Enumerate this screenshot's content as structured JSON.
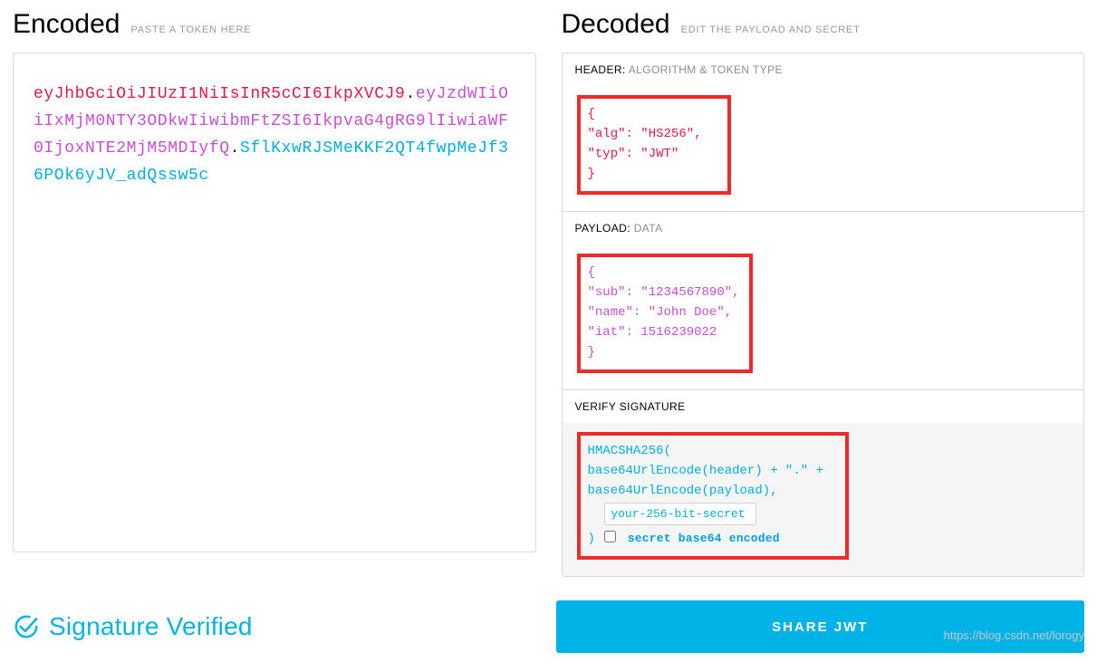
{
  "encoded": {
    "title": "Encoded",
    "subtitle": "PASTE A TOKEN HERE",
    "token_header": "eyJhbGciOiJIUzI1NiIsInR5cCI6IkpXVCJ9",
    "token_payload": "eyJzdWIiOiIxMjM0NTY3ODkwIiwibmFtZSI6IkpvaG4gRG9lIiwiaWF0IjoxNTE2MjM5MDIyfQ",
    "token_signature": "SflKxwRJSMeKKF2QT4fwpMeJf36POk6yJV_adQssw5c"
  },
  "decoded": {
    "title": "Decoded",
    "subtitle": "EDIT THE PAYLOAD AND SECRET",
    "header_label": "HEADER:",
    "header_label_sub": "ALGORITHM & TOKEN TYPE",
    "header_json_lines": [
      "{",
      "  \"alg\": \"HS256\",",
      "  \"typ\": \"JWT\"",
      "}"
    ],
    "payload_label": "PAYLOAD:",
    "payload_label_sub": "DATA",
    "payload_json_lines": [
      "{",
      "  \"sub\": \"1234567890\",",
      "  \"name\": \"John Doe\",",
      "  \"iat\": 1516239022",
      "}"
    ],
    "signature_label": "VERIFY SIGNATURE",
    "sig_line1": "HMACSHA256(",
    "sig_line2": "  base64UrlEncode(header) + \".\" +",
    "sig_line3": "  base64UrlEncode(payload),",
    "sig_secret_value": "your-256-bit-secret",
    "sig_close": ")",
    "sig_checkbox_label": "secret base64 encoded"
  },
  "footer": {
    "verified_text": "Signature Verified",
    "share_label": "SHARE JWT"
  },
  "watermark": "https://blog.csdn.net/lorogy"
}
